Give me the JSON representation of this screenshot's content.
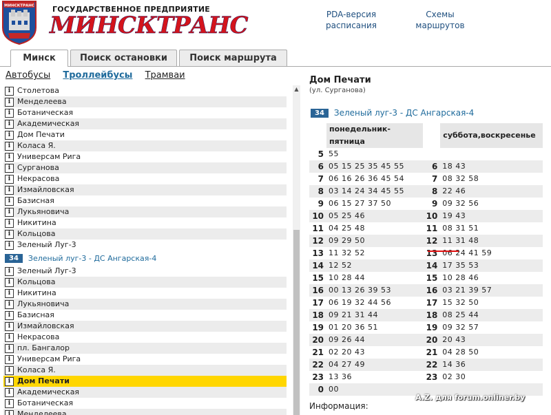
{
  "header": {
    "org_subtitle": "ГОСУДАРСТВЕННОЕ ПРЕДПРИЯТИЕ",
    "org_title": "МИНСКТРАНС",
    "logo_text": "МИНСКТРАНС",
    "pda_link": [
      "PDA-версия",
      "расписания"
    ],
    "maps_link": [
      "Схемы",
      "маршрутов"
    ]
  },
  "tabs": [
    "Минск",
    "Поиск остановки",
    "Поиск маршрута"
  ],
  "transport": [
    "Автобусы",
    "Троллейбусы",
    "Трамваи"
  ],
  "list": {
    "stops_a": [
      "Столетова",
      "Менделеева",
      "Ботаническая",
      "Академическая",
      "Дом Печати",
      "Коласа Я.",
      "Универсам Рига",
      "Сурганова",
      "Некрасова",
      "Измайловская",
      "Базисная",
      "Лукьяновича",
      "Никитина",
      "Кольцова",
      "Зеленый Луг-3"
    ],
    "route": {
      "number": "34",
      "name": "Зеленый луг-3 - ДС Ангарская-4"
    },
    "stops_b": [
      "Зеленый Луг-3",
      "Кольцова",
      "Никитина",
      "Лукьяновича",
      "Базисная",
      "Измайловская",
      "Некрасова",
      "пл. Бангалор",
      "Универсам Рига",
      "Коласа Я.",
      "Дом Печати",
      "Академическая",
      "Ботаническая",
      "Менделеева"
    ],
    "highlighted": "Дом Печати"
  },
  "stop": {
    "title": "Дом Печати",
    "street": "(ул. Сурганова)",
    "route_number": "34",
    "route_name": "Зеленый луг-3 - ДС Ангарская-4"
  },
  "schedule": {
    "weekday_header": "понедельник-пятница",
    "weekend_header": "суббота,воскресенье",
    "rows": [
      {
        "wh": "5",
        "wm": "55",
        "eh": "",
        "em": ""
      },
      {
        "wh": "6",
        "wm": "05 15 25 35 45 55",
        "eh": "6",
        "em": "18 43"
      },
      {
        "wh": "7",
        "wm": "06 16 26 36 45 54",
        "eh": "7",
        "em": "08 32 58"
      },
      {
        "wh": "8",
        "wm": "03 14 24 34 45 55",
        "eh": "8",
        "em": "22 46"
      },
      {
        "wh": "9",
        "wm": "06 15 27 37 50",
        "eh": "9",
        "em": "09 32 56"
      },
      {
        "wh": "10",
        "wm": "05 25 46",
        "eh": "10",
        "em": "19 43"
      },
      {
        "wh": "11",
        "wm": "04 25 48",
        "eh": "11",
        "em": "08 31 51"
      },
      {
        "wh": "12",
        "wm": "09 29 50",
        "eh": "12",
        "em": "11 31 48"
      },
      {
        "wh": "13",
        "wm": "11 32 52",
        "eh": "13",
        "em": "06 24 41 59"
      },
      {
        "wh": "14",
        "wm": "12 52",
        "eh": "14",
        "em": "17 35 53"
      },
      {
        "wh": "15",
        "wm": "10 28 44",
        "eh": "15",
        "em": "10 28 46"
      },
      {
        "wh": "16",
        "wm": "00 13 26 39 53",
        "eh": "16",
        "em": "03 21 39 57"
      },
      {
        "wh": "17",
        "wm": "06 19 32 44 56",
        "eh": "17",
        "em": "15 32 50"
      },
      {
        "wh": "18",
        "wm": "09 21 31 44",
        "eh": "18",
        "em": "08 25 44"
      },
      {
        "wh": "19",
        "wm": "01 20 36 51",
        "eh": "19",
        "em": "09 32 57"
      },
      {
        "wh": "20",
        "wm": "09 26 44",
        "eh": "20",
        "em": "20 43"
      },
      {
        "wh": "21",
        "wm": "02 20 43",
        "eh": "21",
        "em": "04 28 50"
      },
      {
        "wh": "22",
        "wm": "04 27 49",
        "eh": "22",
        "em": "14 36"
      },
      {
        "wh": "23",
        "wm": "13 36",
        "eh": "23",
        "em": "02 30"
      },
      {
        "wh": "0",
        "wm": "00",
        "eh": "",
        "em": ""
      }
    ]
  },
  "info_label": "Информация:",
  "watermark": "A.Z. для forum.onliner.by",
  "colors": {
    "brand_red": "#d4141c",
    "link_blue": "#1f6b9c",
    "highlight": "#ffd600",
    "badge": "#2a6496"
  }
}
